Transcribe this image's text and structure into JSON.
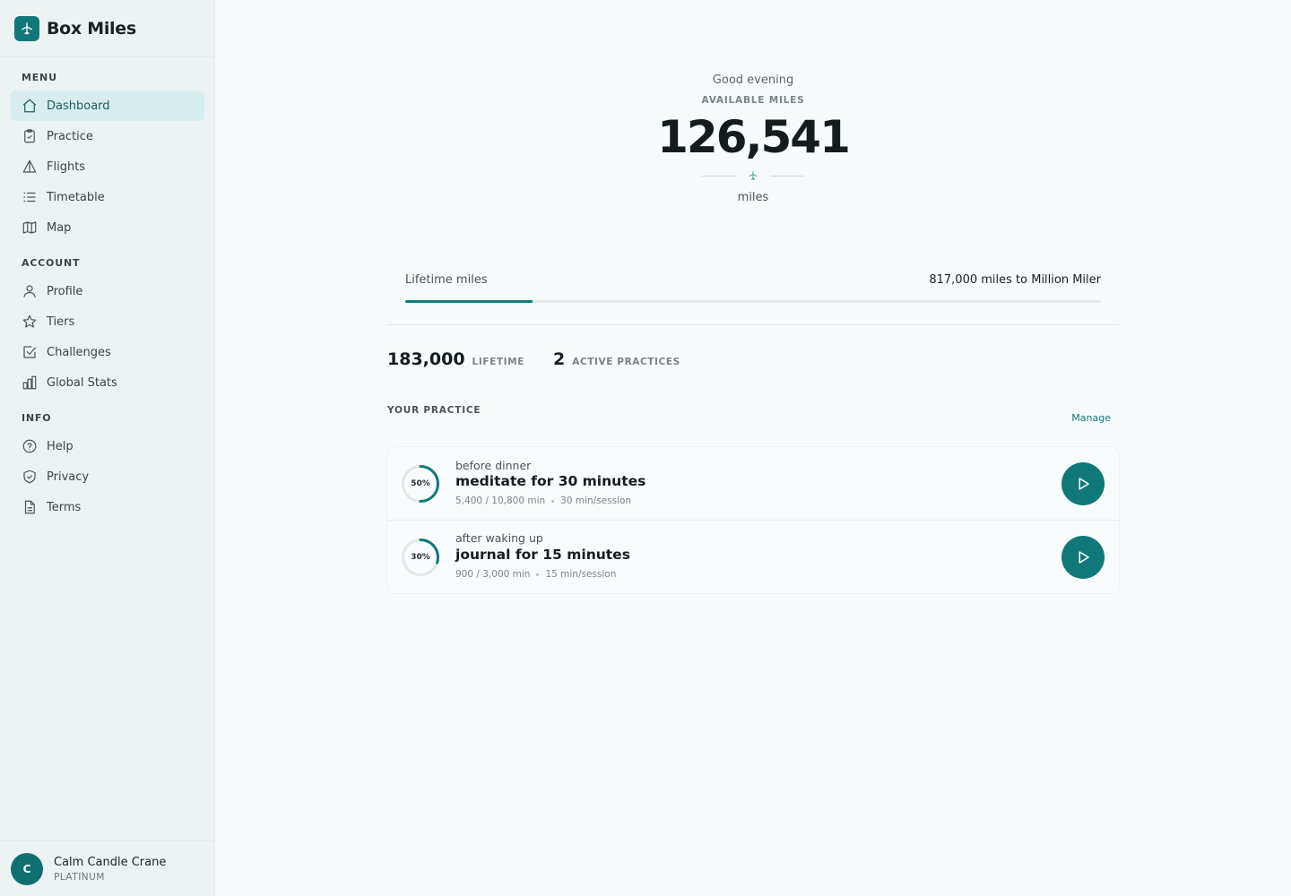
{
  "app": {
    "name": "Box Miles",
    "logo_icon": "plane-icon",
    "accent": "#11787a"
  },
  "sidebar": {
    "sections": [
      {
        "label": "MENU"
      },
      {
        "label": "ACCOUNT"
      },
      {
        "label": "INFO"
      }
    ],
    "items": [
      {
        "label": "Dashboard",
        "icon": "home-icon",
        "active": true
      },
      {
        "label": "Practice",
        "icon": "clipboard-icon"
      },
      {
        "label": "Flights",
        "icon": "triangle-icon"
      },
      {
        "label": "Timetable",
        "icon": "list-icon"
      },
      {
        "label": "Map",
        "icon": "map-icon"
      },
      {
        "label": "Profile",
        "icon": "user-icon"
      },
      {
        "label": "Tiers",
        "icon": "star-icon"
      },
      {
        "label": "Challenges",
        "icon": "checkbox-icon"
      },
      {
        "label": "Global Stats",
        "icon": "bar-chart-icon"
      },
      {
        "label": "Help",
        "icon": "help-circle-icon"
      },
      {
        "label": "Privacy",
        "icon": "shield-icon"
      },
      {
        "label": "Terms",
        "icon": "document-icon"
      }
    ],
    "user": {
      "initial": "C",
      "name": "Calm Candle Crane",
      "tier": "PLATINUM"
    }
  },
  "hero": {
    "greeting": "Good evening",
    "label": "AVAILABLE MILES",
    "value": "126,541",
    "unit": "miles"
  },
  "lifetime": {
    "label": "Lifetime miles",
    "remaining_text": "817,000 miles to Million Miler",
    "progress_fraction": 0.183
  },
  "stats": [
    {
      "value": "183,000",
      "label": "LIFETIME"
    },
    {
      "value": "2",
      "label": "ACTIVE PRACTICES"
    }
  ],
  "practice": {
    "heading": "YOUR PRACTICE",
    "manage_label": "Manage",
    "items": [
      {
        "percent_label": "50%",
        "percent": 0.5,
        "trigger": "before dinner",
        "habit": "meditate for 30 minutes",
        "progress": "5,400 / 10,800 min",
        "rate": "30 min/session"
      },
      {
        "percent_label": "30%",
        "percent": 0.3,
        "trigger": "after waking up",
        "habit": "journal for 15 minutes",
        "progress": "900 / 3,000 min",
        "rate": "15 min/session"
      }
    ]
  }
}
